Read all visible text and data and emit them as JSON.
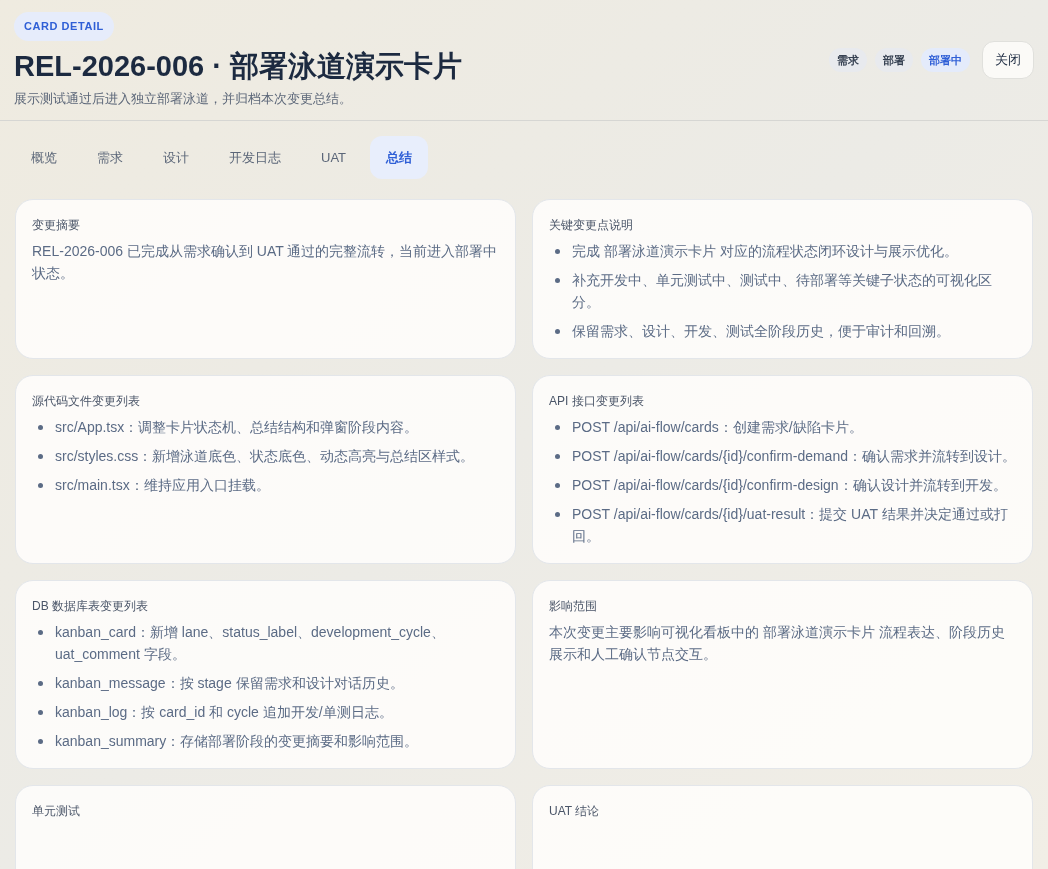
{
  "header": {
    "eyebrow": "CARD DETAIL",
    "title": "REL-2026-006 · 部署泳道演示卡片",
    "subtitle": "展示测试通过后进入独立部署泳道，并归档本次变更总结。",
    "tags": [
      {
        "label": "需求",
        "active": false
      },
      {
        "label": "部署",
        "active": false
      },
      {
        "label": "部署中",
        "active": true
      }
    ],
    "close_button": "关闭"
  },
  "tabs": [
    {
      "label": "概览",
      "selected": false
    },
    {
      "label": "需求",
      "selected": false
    },
    {
      "label": "设计",
      "selected": false
    },
    {
      "label": "开发日志",
      "selected": false
    },
    {
      "label": "UAT",
      "selected": false
    },
    {
      "label": "总结",
      "selected": true
    }
  ],
  "cards": [
    {
      "title": "变更摘要",
      "kind": "text",
      "text": "REL-2026-006 已完成从需求确认到 UAT 通过的完整流转，当前进入部署中状态。"
    },
    {
      "title": "关键变更点说明",
      "kind": "list",
      "items": [
        "完成 部署泳道演示卡片 对应的流程状态闭环设计与展示优化。",
        "补充开发中、单元测试中、测试中、待部署等关键子状态的可视化区分。",
        "保留需求、设计、开发、测试全阶段历史，便于审计和回溯。"
      ]
    },
    {
      "title": "源代码文件变更列表",
      "kind": "list",
      "items": [
        "src/App.tsx：调整卡片状态机、总结结构和弹窗阶段内容。",
        "src/styles.css：新增泳道底色、状态底色、动态高亮与总结区样式。",
        "src/main.tsx：维持应用入口挂载。"
      ]
    },
    {
      "title": "API 接口变更列表",
      "kind": "list",
      "items": [
        "POST /api/ai-flow/cards：创建需求/缺陷卡片。",
        "POST /api/ai-flow/cards/{id}/confirm-demand：确认需求并流转到设计。",
        "POST /api/ai-flow/cards/{id}/confirm-design：确认设计并流转到开发。",
        "POST /api/ai-flow/cards/{id}/uat-result：提交 UAT 结果并决定通过或打回。"
      ]
    },
    {
      "title": "DB 数据库表变更列表",
      "kind": "list",
      "items": [
        "kanban_card：新增 lane、status_label、development_cycle、uat_comment 字段。",
        "kanban_message：按 stage 保留需求和设计对话历史。",
        "kanban_log：按 card_id 和 cycle 追加开发/单测日志。",
        "kanban_summary：存储部署阶段的变更摘要和影响范围。"
      ]
    },
    {
      "title": "影响范围",
      "kind": "text",
      "text": "本次变更主要影响可视化看板中的 部署泳道演示卡片 流程表达、阶段历史展示和人工确认节点交互。"
    },
    {
      "title": "单元测试",
      "kind": "empty"
    },
    {
      "title": "UAT 结论",
      "kind": "empty"
    }
  ]
}
